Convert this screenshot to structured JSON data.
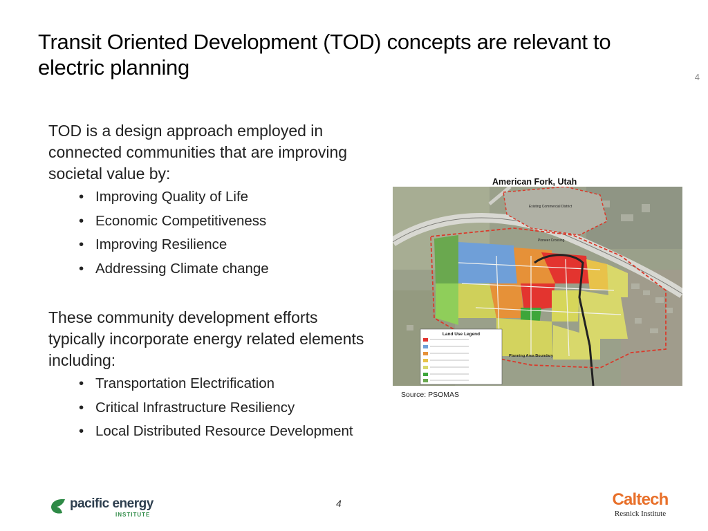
{
  "slide": {
    "title": "Transit Oriented Development (TOD) concepts are relevant to electric planning",
    "slide_number_top": "4",
    "page_number": "4"
  },
  "content": {
    "intro": "TOD is a design approach employed in connected communities that are improving societal value by:",
    "benefits": [
      "Improving Quality of Life",
      "Economic Competitiveness",
      "Improving Resilience",
      "Addressing Climate change"
    ],
    "elements_intro": "These community development efforts typically incorporate energy related elements including:",
    "elements": [
      "Transportation Electrification",
      "Critical Infrastructure Resiliency",
      "Local Distributed Resource Development"
    ]
  },
  "figure": {
    "caption": "American Fork, Utah",
    "source": "Source: PSOMAS",
    "labels": {
      "existing_commercial": "Existing Commercial District",
      "pioneer_crossing": "Pioneer Crossing",
      "legend_title": "Land Use Legend",
      "planning_boundary": "Planning Area Boundary"
    }
  },
  "logos": {
    "pei_name": "pacific energy",
    "pei_sub": "INSTITUTE",
    "caltech_name": "Caltech",
    "caltech_sub": "Resnick Institute"
  },
  "colors": {
    "pei_green": "#2e8a46",
    "pei_dark": "#2d3e4e",
    "caltech_orange": "#e8702a",
    "boundary_red": "#d93a2b"
  }
}
